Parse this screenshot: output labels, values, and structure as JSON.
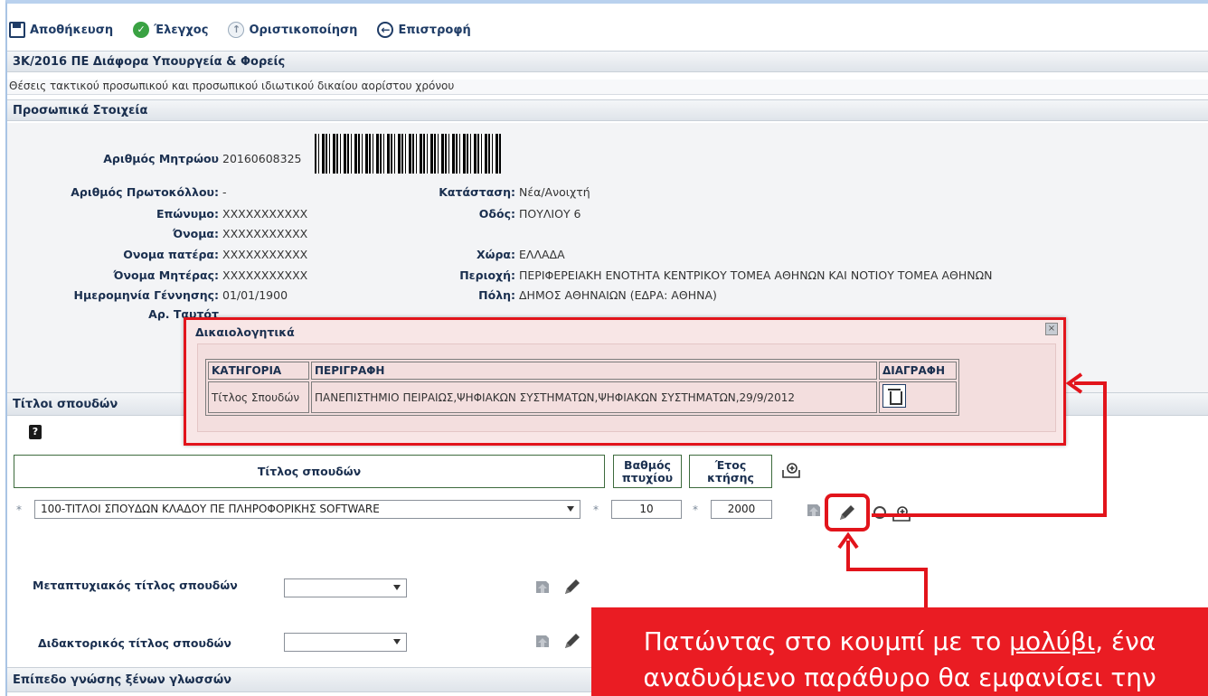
{
  "toolbar": {
    "save": "Αποθήκευση",
    "check": "Έλεγχος",
    "finalize": "Οριστικοποίηση",
    "back": "Επιστροφή"
  },
  "call_title": "3Κ/2016 ΠΕ Διάφορα Υπουργεία & Φορείς",
  "call_subtitle": "Θέσεις τακτικού προσωπικού και προσωπικού ιδιωτικού δικαίου αορίστου χρόνου",
  "personal": {
    "section_title": "Προσωπικά Στοιχεία",
    "registry_label": "Αριθμός Μητρώου",
    "registry_value": "20160608325",
    "protocol_label": "Αριθμός Πρωτοκόλλου:",
    "protocol_value": "-",
    "surname_label": "Επώνυμο:",
    "surname_value": "XXXXXXXXXXX",
    "name_label": "Όνομα:",
    "name_value": "XXXXXXXXXXX",
    "father_label": "Ονομα πατέρα:",
    "father_value": "XXXXXXXXXXX",
    "mother_label": "Όνομα Μητέρας:",
    "mother_value": "XXXXXXXXXXX",
    "birth_label": "Ημερομηνία Γέννησης:",
    "birth_value": "01/01/1900",
    "id_label": "Αρ. Ταυτότ",
    "status_label": "Κατάσταση:",
    "status_value": "Νέα/Ανοιχτή",
    "street_label": "Οδός:",
    "street_value": "ΠΟΥΛΙΟΥ 6",
    "country_label": "Χώρα:",
    "country_value": "ΕΛΛΑΔΑ",
    "region_label": "Περιοχή:",
    "region_value": "ΠΕΡΙΦΕΡΕΙΑΚΗ ΕΝΟΤΗΤΑ ΚΕΝΤΡΙΚΟΥ ΤΟΜΕΑ ΑΘΗΝΩΝ ΚΑΙ ΝΟΤΙΟΥ ΤΟΜΕΑ ΑΘΗΝΩΝ",
    "city_label": "Πόλη:",
    "city_value": "ΔΗΜΟΣ ΑΘΗΝΑΙΩΝ (ΕΔΡΑ: ΑΘΗΝΑ)"
  },
  "modal": {
    "title": "Δικαιολογητικά",
    "close": "×",
    "columns": [
      "ΚΑΤΗΓΟΡΙΑ",
      "ΠΕΡΙΓΡΑΦΗ",
      "ΔΙΑΓΡΑΦΗ"
    ],
    "rows": [
      {
        "category": "Τίτλος Σπουδών",
        "description": "ΠΑΝΕΠΙΣΤΗΜΙΟ ΠΕΙΡΑΙΩΣ,ΨΗΦΙΑΚΩΝ ΣΥΣΤΗΜΑΤΩΝ,ΨΗΦΙΑΚΩΝ ΣΥΣΤΗΜΑΤΩΝ,29/9/2012"
      }
    ]
  },
  "studies": {
    "section_title": "Τίτλοι σπουδών",
    "help": "?",
    "col_title": "Τίτλος σπουδών",
    "col_grade": "Βαθμός πτυχίου",
    "col_year": "Έτος κτήσης",
    "row": {
      "title": "100-ΤΙΤΛΟΙ ΣΠΟΥΔΩΝ ΚΛΑΔΟΥ ΠΕ ΠΛΗΡΟΦΟΡΙΚΗΣ SOFTWARE",
      "grade": "10",
      "year": "2000"
    },
    "required_mark": "*",
    "masters_label": "Μεταπτυχιακός τίτλος σπουδών",
    "phd_label": "Διδακτορικός τίτλος σπουδών"
  },
  "languages_title": "Επίπεδο γνώσης ξένων γλωσσών",
  "callout": {
    "line1_pre": "Πατώντας στο κουμπί με το ",
    "line1_u": "μολύβι",
    "line1_post": ", ένα",
    "line2": "αναδυόμενο παράθυρο θα εμφανίσει την"
  },
  "colors": {
    "accent_red": "#e2141b",
    "header_blue": "#1a2f4f",
    "callout_red": "#ea1c23"
  }
}
